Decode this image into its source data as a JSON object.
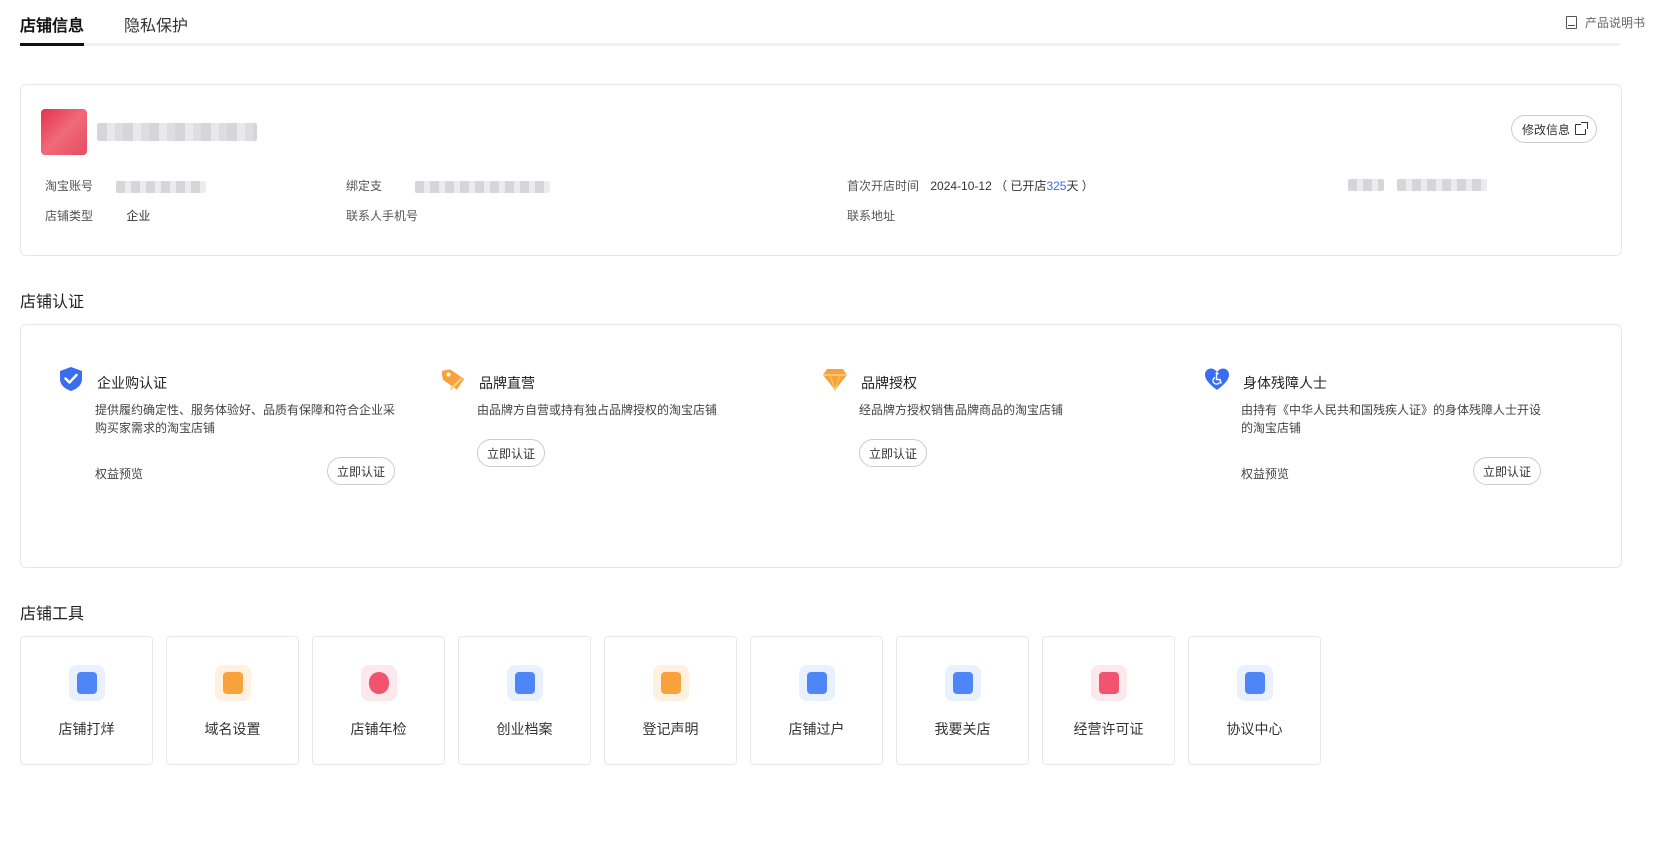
{
  "tabs": [
    {
      "label": "店铺信息",
      "active": true
    },
    {
      "label": "隐私保护",
      "active": false
    }
  ],
  "manual_link": "产品说明书",
  "shop_info": {
    "edit_button": "修改信息",
    "fields": {
      "taobao_account_label": "淘宝账号",
      "bind_alipay_label": "绑定支",
      "first_open_label": "首次开店时间",
      "first_open_date": "2024-10-12",
      "open_days_prefix": "（ 已开店",
      "open_days": "325",
      "open_days_suffix": "天 ）",
      "shop_type_label": "店铺类型",
      "shop_type_value": "企业",
      "contact_phone_label": "联系人手机号",
      "contact_address_label": "联系地址"
    }
  },
  "certification": {
    "title": "店铺认证",
    "items": [
      {
        "title": "企业购认证",
        "desc": "提供履约确定性、服务体验好、品质有保障和符合企业采购买家需求的淘宝店铺",
        "benefit": "权益预览",
        "button": "立即认证",
        "icon": "shield-check-icon",
        "color": "#3a6df0"
      },
      {
        "title": "品牌直营",
        "desc": "由品牌方自营或持有独占品牌授权的淘宝店铺",
        "benefit": "",
        "button": "立即认证",
        "icon": "price-tag-icon",
        "color": "#f7a23a"
      },
      {
        "title": "品牌授权",
        "desc": "经品牌方授权销售品牌商品的淘宝店铺",
        "benefit": "",
        "button": "立即认证",
        "icon": "gem-icon",
        "color": "#f7a23a"
      },
      {
        "title": "身体残障人士",
        "desc": "由持有《中华人民共和国残疾人证》的身体残障人士开设的淘宝店铺",
        "benefit": "权益预览",
        "button": "立即认证",
        "icon": "accessibility-heart-icon",
        "color": "#3a6df0"
      }
    ]
  },
  "tools": {
    "title": "店铺工具",
    "items": [
      {
        "label": "店铺打烊",
        "icon": "shop-closed-icon",
        "color": "#4f86f7"
      },
      {
        "label": "域名设置",
        "icon": "domain-settings-icon",
        "color": "#f7a23a"
      },
      {
        "label": "店铺年检",
        "icon": "annual-inspection-icon",
        "color": "#f0546e"
      },
      {
        "label": "创业档案",
        "icon": "business-archive-icon",
        "color": "#4f86f7"
      },
      {
        "label": "登记声明",
        "icon": "registration-statement-icon",
        "color": "#f7a23a"
      },
      {
        "label": "店铺过户",
        "icon": "shop-transfer-icon",
        "color": "#4f86f7"
      },
      {
        "label": "我要关店",
        "icon": "close-shop-icon",
        "color": "#4f86f7"
      },
      {
        "label": "经营许可证",
        "icon": "business-license-icon",
        "color": "#f0546e"
      },
      {
        "label": "协议中心",
        "icon": "agreement-center-icon",
        "color": "#4f86f7"
      }
    ]
  }
}
